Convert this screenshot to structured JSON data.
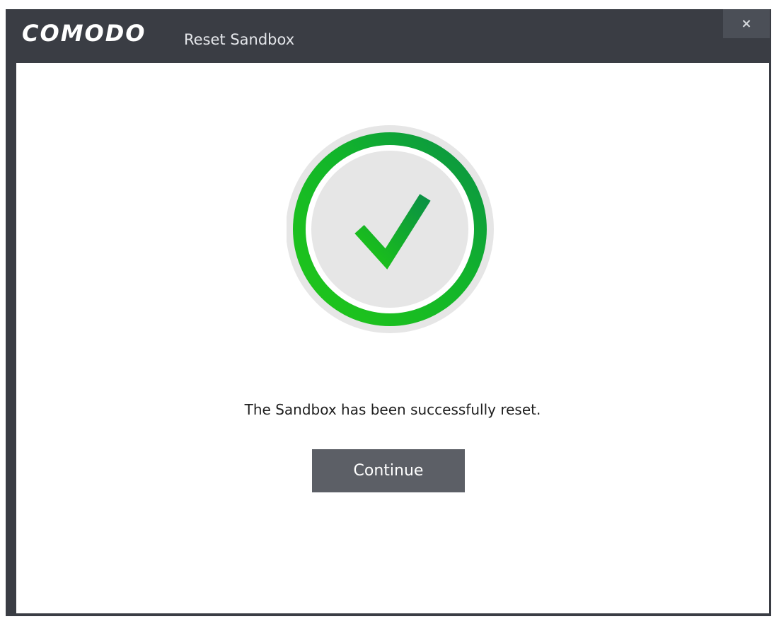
{
  "window": {
    "logo_text": "COMODO",
    "title": "Reset Sandbox",
    "close_glyph": "×"
  },
  "status": {
    "icon": "checkmark-success-icon",
    "message": "The Sandbox has been successfully reset."
  },
  "actions": {
    "continue_label": "Continue"
  },
  "colors": {
    "titlebar": "#3a3d44",
    "success_green_light": "#1fc41a",
    "success_green_dark": "#0a8f3e",
    "button_bg": "#5c5f66"
  }
}
